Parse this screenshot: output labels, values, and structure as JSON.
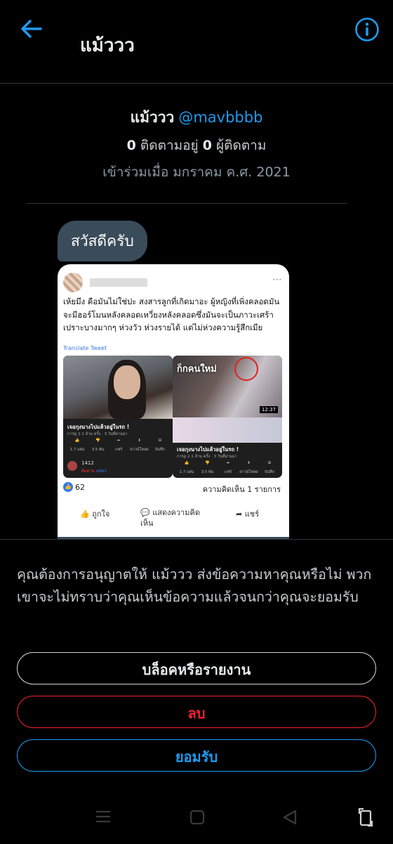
{
  "header": {
    "title": "แม้ววว"
  },
  "profile": {
    "name": "แม้ววว",
    "handle": "@mavbbbb",
    "following_count": "0",
    "following_label": "ติดตามอยู่",
    "followers_count": "0",
    "followers_label": "ผู้ติดตาม",
    "joined": "เข้าร่วมเมื่อ มกราคม ค.ศ. 2021"
  },
  "message": {
    "text": "สวัสดีครับ",
    "attachment": {
      "post_text": "เห้ยมึง คือมันไม่ใช่ปะ สงสารลูกที่เกิดมาอะ ผู้หญิงที่เพิ่งคลอดมันจะมีฮอร์โมนหลังคลอดเหวี่ยงหลังคลอดซึ่งมันจะเป็นภาวะเศร้าเปราะบางมากๆ ห่วงวัว ห่วงรายได้ แต่ไม่ห่วงความรู้สึกเมีย",
      "translate": "Translate Tweet",
      "video1_title": "เจอกุงนางไปแล้วอยู่ในรถ !",
      "video1_sub": "การดู 2.1 ล้าน ครั้ง · 3 วันที่ผ่านมา",
      "video2_overlay": "ก็กคนใหม่",
      "video2_duration": "12:37",
      "video2_title": "เจอกุงนางไปแล้วอยู่ในรถ !",
      "video2_sub": "การดู 2.1 ล้าน ครั้ง · 3 วันที่ผ่านมา",
      "video_actions": [
        "1.7 แสน",
        "3.5 พัน",
        "แชร์",
        "ดาวน์โหลด",
        "บันทึก"
      ],
      "channel_subs": "1412",
      "channel_follow": "ติดตาม",
      "channel_extra": "สมัคร",
      "like_count": "62",
      "comment_count": "ความคิดเห็น 1 รายการ",
      "action_like": "ถูกใจ",
      "action_comment": "แสดงความคิดเห็น",
      "action_share": "แชร์"
    }
  },
  "request": {
    "prompt": "คุณต้องการอนุญาตให้ แม้ววว ส่งข้อความหาคุณหรือไม่ พวกเขาจะไม่ทราบว่าคุณเห็นข้อความแล้วจนกว่าคุณจะยอมรับ",
    "block_label": "บล็อคหรือรายงาน",
    "delete_label": "ลบ",
    "accept_label": "ยอมรับ"
  },
  "colors": {
    "accent": "#1d9bf0",
    "danger": "#f4212e",
    "background": "#000000",
    "bubble": "#3a4b5a"
  },
  "icons": {
    "back": "arrow-left-icon",
    "info": "info-icon",
    "nav": [
      "menu-icon",
      "home-square-icon",
      "back-triangle-icon",
      "rotate-icon"
    ]
  }
}
